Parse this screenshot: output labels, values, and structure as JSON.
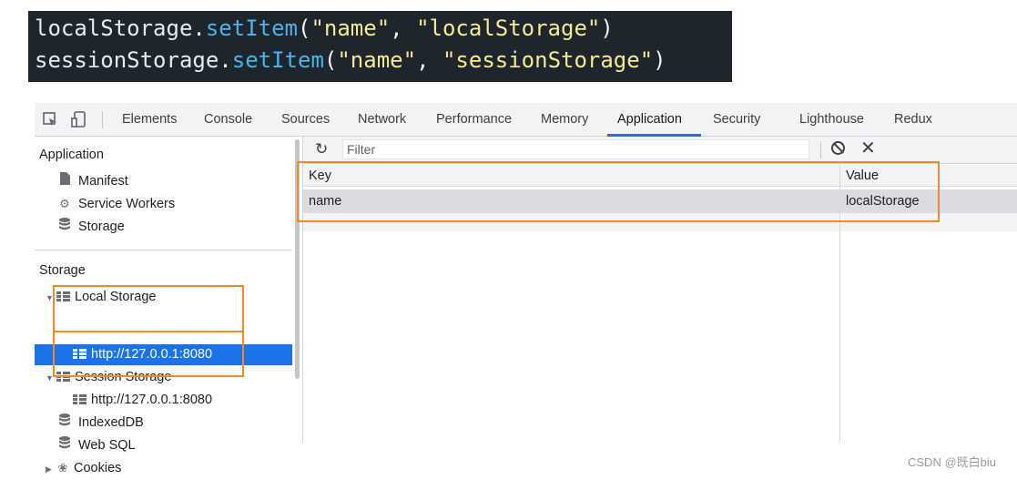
{
  "code": {
    "line1": {
      "obj": "localStorage",
      "dot": ".",
      "fn": "setItem",
      "open": "(",
      "arg1": "\"name\"",
      "comma": ", ",
      "arg2": "\"localStorage\"",
      "close": ")"
    },
    "line2": {
      "obj": "sessionStorage",
      "dot": ".",
      "fn": "setItem",
      "open": "(",
      "arg1": "\"name\"",
      "comma": ", ",
      "arg2": "\"sessionStorage\"",
      "close": ")"
    }
  },
  "devtools": {
    "tabs": [
      "Elements",
      "Console",
      "Sources",
      "Network",
      "Performance",
      "Memory",
      "Application",
      "Security",
      "Lighthouse",
      "Redux"
    ],
    "active_tab": "Application",
    "sidebar": {
      "application_heading": "Application",
      "application_items": [
        "Manifest",
        "Service Workers",
        "Storage"
      ],
      "storage_heading": "Storage",
      "local_storage": "Local Storage",
      "local_storage_origin": "http://127.0.0.1:8080",
      "session_storage": "Session Storage",
      "session_storage_origin": "http://127.0.0.1:8080",
      "indexeddb": "IndexedDB",
      "websql": "Web SQL",
      "cookies": "Cookies"
    },
    "filter": {
      "placeholder": "Filter"
    },
    "table": {
      "columns": [
        "Key",
        "Value"
      ],
      "rows": [
        {
          "key": "name",
          "value": "localStorage"
        }
      ]
    }
  },
  "watermark": "CSDN @既白biu",
  "colors": {
    "accent": "#1a73e8",
    "highlight": "#f08a24",
    "code_bg": "#1e252c",
    "code_fn": "#4fb2ea",
    "code_str": "#f4ea92"
  },
  "icons": [
    "inspect-icon",
    "device-icon",
    "file-icon",
    "gear-icon",
    "database-icon",
    "table-icon",
    "cookie-icon",
    "refresh-icon",
    "block-icon",
    "close-icon"
  ]
}
